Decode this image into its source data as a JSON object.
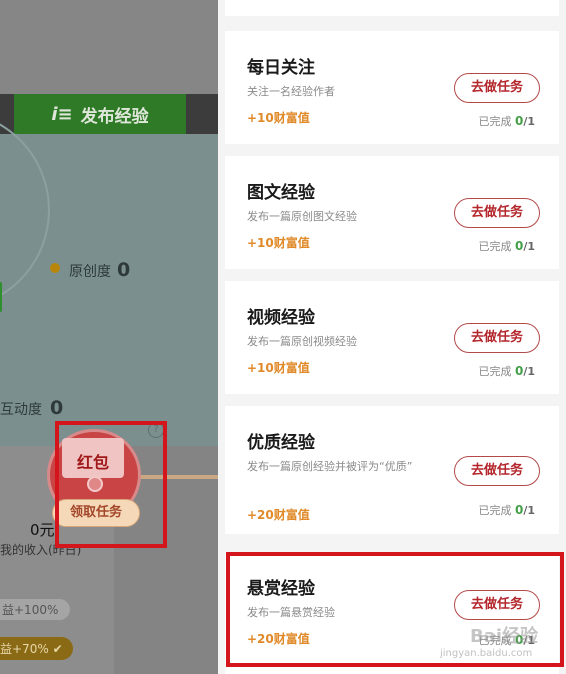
{
  "background": {
    "publish_button_label": "发布经验",
    "publish_icon": "i≡",
    "originality_label": "原创度",
    "originality_value": "0",
    "interaction_label": "互动度",
    "interaction_value": "0",
    "income_value": "0元",
    "income_label": "我的收入(昨日)",
    "bonus_1": "益+100%",
    "bonus_2": "益+70%",
    "help_icon": "?"
  },
  "red_envelope": {
    "label": "红包",
    "claim_button": "领取任务"
  },
  "tasks": [
    {
      "title": "每日关注",
      "desc": "关注一名经验作者",
      "reward": "+10财富值",
      "button": "去做任务",
      "progress_label": "已完成",
      "done": "0",
      "total": "/1"
    },
    {
      "title": "图文经验",
      "desc": "发布一篇原创图文经验",
      "reward": "+10财富值",
      "button": "去做任务",
      "progress_label": "已完成",
      "done": "0",
      "total": "/1"
    },
    {
      "title": "视频经验",
      "desc": "发布一篇原创视频经验",
      "reward": "+10财富值",
      "button": "去做任务",
      "progress_label": "已完成",
      "done": "0",
      "total": "/1"
    },
    {
      "title": "优质经验",
      "desc": "发布一篇原创经验并被评为“优质”",
      "reward": "+20财富值",
      "button": "去做任务",
      "progress_label": "已完成",
      "done": "0",
      "total": "/1"
    },
    {
      "title": "悬赏经验",
      "desc": "发布一篇悬赏经验",
      "reward": "+20财富值",
      "button": "去做任务",
      "progress_label": "已完成",
      "done": "0",
      "total": "/1"
    }
  ],
  "watermark": {
    "text": "Bai经验",
    "sub": "jingyan.baidu.com"
  },
  "colors": {
    "accent_red": "#b3262b",
    "reward_orange": "#e08a2a",
    "progress_green": "#43a047",
    "highlight_red": "#d4161c"
  }
}
